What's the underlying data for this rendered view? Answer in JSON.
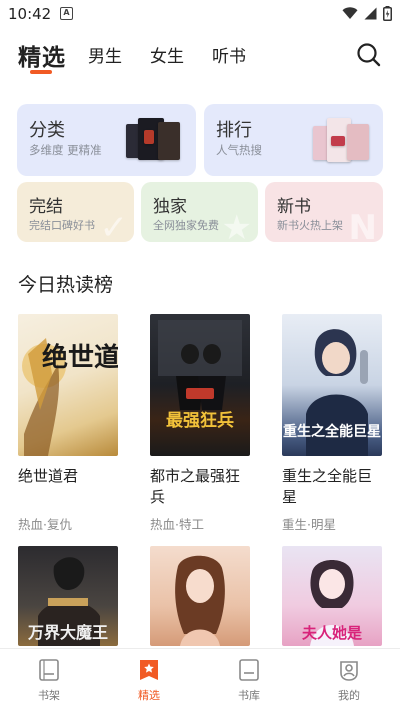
{
  "status": {
    "time": "10:42",
    "notif_glyph": "A"
  },
  "topnav": {
    "tabs": [
      "精选",
      "男生",
      "女生",
      "听书"
    ],
    "active": "精选",
    "accent": "#f15a24"
  },
  "cards": {
    "fenlei": {
      "title": "分类",
      "subtitle": "多维度  更精准"
    },
    "paihang": {
      "title": "排行",
      "subtitle": "人气热搜"
    },
    "wanjie": {
      "title": "完结",
      "subtitle": "完结口碑好书"
    },
    "dujia": {
      "title": "独家",
      "subtitle": "全网独家免费"
    },
    "xinshu": {
      "title": "新书",
      "subtitle": "新书火热上架"
    }
  },
  "section": {
    "title": "今日热读榜"
  },
  "books": [
    {
      "title": "绝世道君",
      "tag": "热血·复仇",
      "cover_text": "绝世道君"
    },
    {
      "title": "都市之最强狂兵",
      "tag": "热血·特工",
      "cover_text": "最强狂兵"
    },
    {
      "title": "重生之全能巨星",
      "tag": "重生·明星",
      "cover_text": "重生之全能巨星"
    },
    {
      "title": "",
      "tag": "",
      "cover_text": "万界大魔王"
    },
    {
      "title": "",
      "tag": "",
      "cover_text": ""
    },
    {
      "title": "",
      "tag": "",
      "cover_text": "夫人她是"
    }
  ],
  "bottomnav": {
    "items": [
      "书架",
      "精选",
      "书库",
      "我的"
    ],
    "active": "精选"
  },
  "icons": [
    "search-icon",
    "wifi-icon",
    "signal-icon",
    "battery-icon",
    "bookshelf-icon",
    "featured-icon",
    "library-icon",
    "profile-icon"
  ]
}
